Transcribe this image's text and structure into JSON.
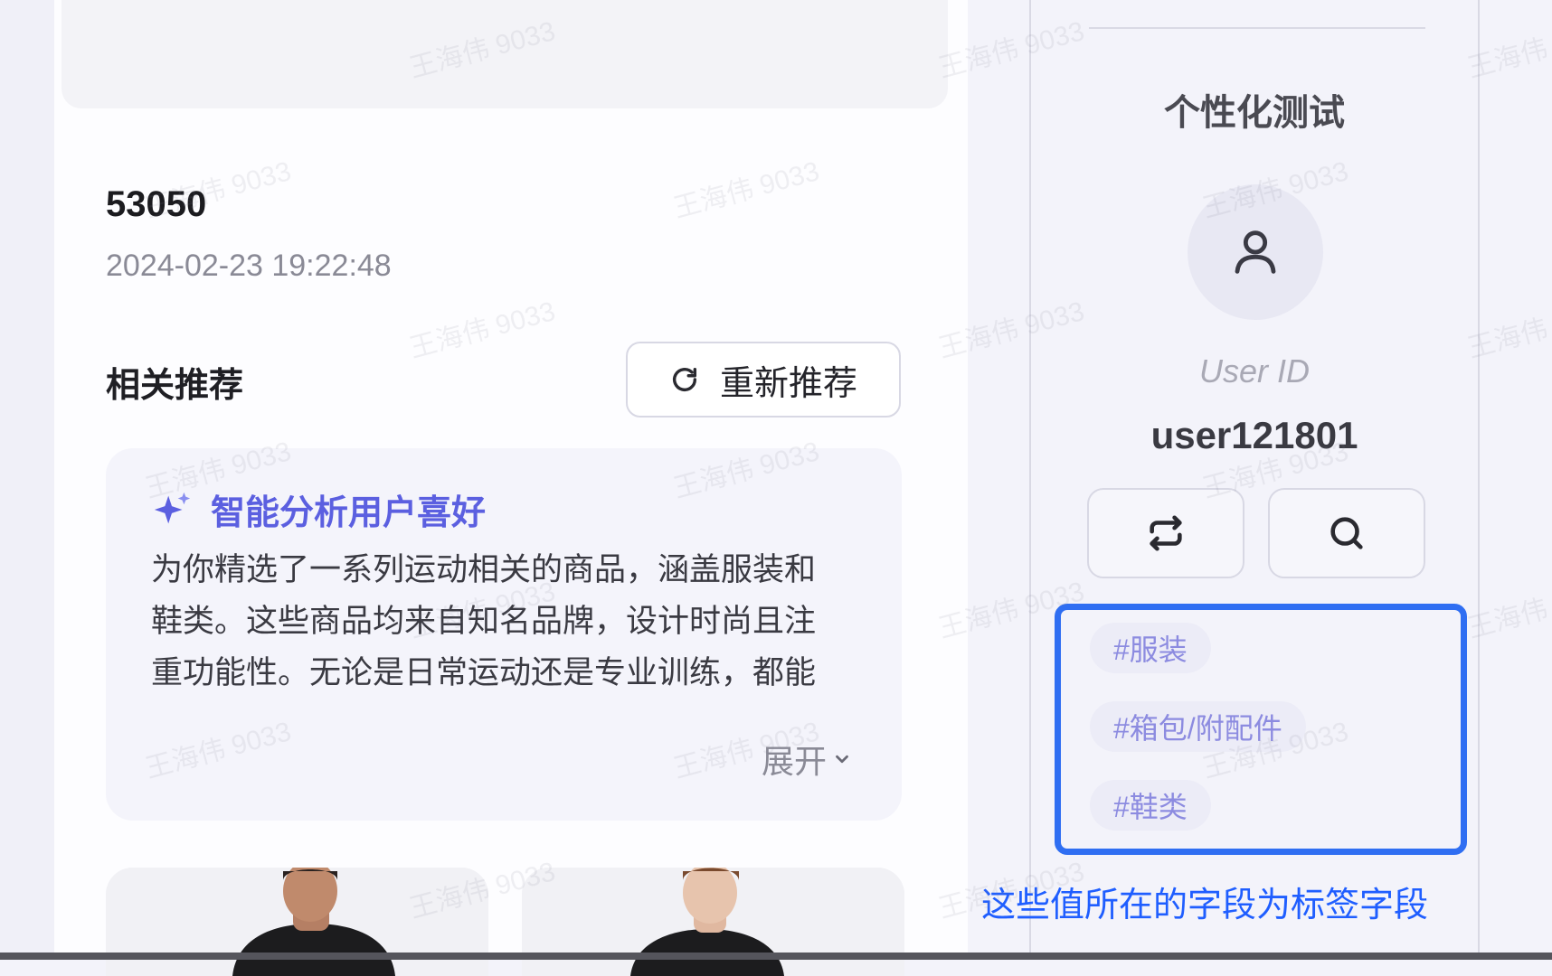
{
  "order": {
    "id": "53050",
    "datetime": "2024-02-23 19:22:48"
  },
  "recommend": {
    "title": "相关推荐",
    "refresh_label": "重新推荐",
    "ai": {
      "title": "智能分析用户喜好",
      "text": "为你精选了一系列运动相关的商品，涵盖服装和鞋类。这些商品均来自知名品牌，设计时尚且注重功能性。无论是日常运动还是专业训练，都能满足你的需求，非常契合你的潜在需求。",
      "expand_label": "展开"
    }
  },
  "panel": {
    "title": "个性化测试",
    "user_id_label": "User ID",
    "user_id": "user121801",
    "tags": [
      "#服装",
      "#箱包/附配件",
      "#鞋类"
    ]
  },
  "annotation": "这些值所在的字段为标签字段",
  "watermark": "王海伟 9033",
  "colors": {
    "accent": "#5b5fe0",
    "highlight_box": "#2f6ef2",
    "tag_text": "#8c8be0"
  },
  "icons": {
    "refresh": "refresh-icon",
    "ai": "sparkle-icon",
    "expand": "chevron-down-icon",
    "avatar": "user-icon",
    "switch": "switch-icon",
    "search": "search-icon"
  }
}
